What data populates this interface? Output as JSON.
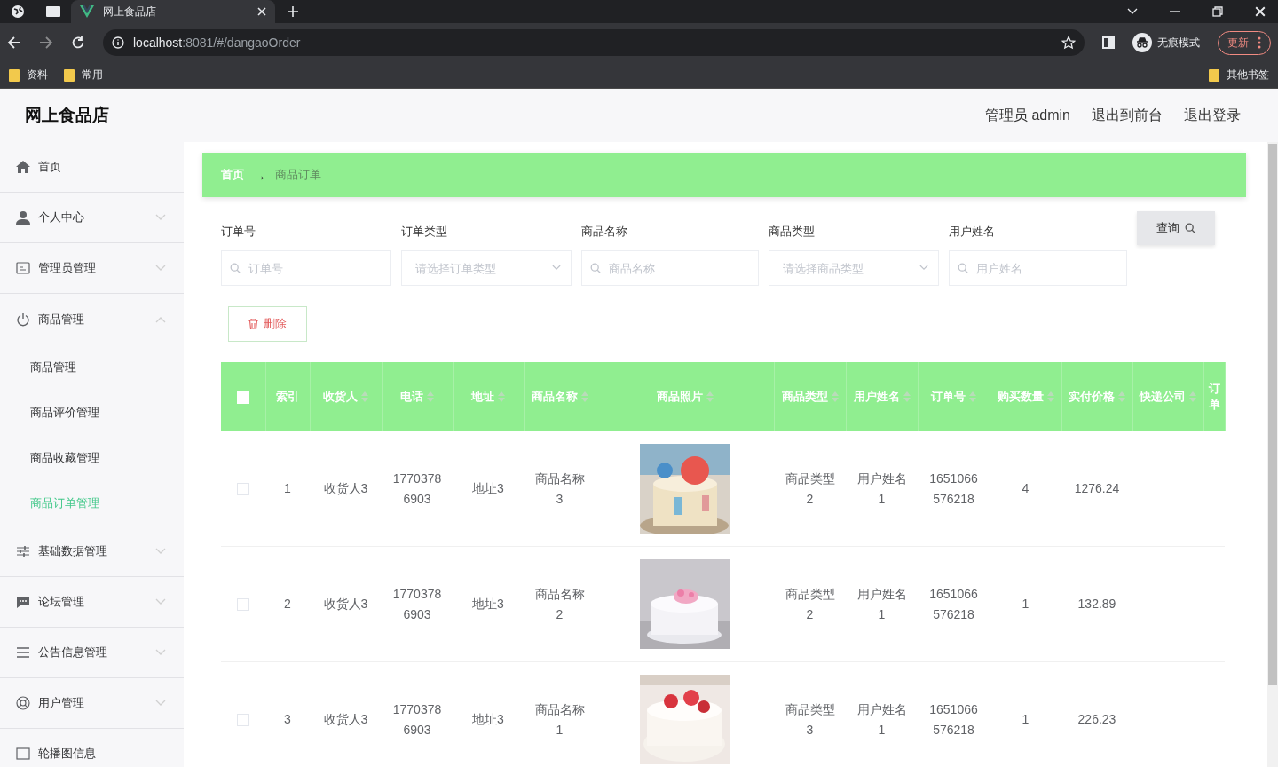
{
  "browser": {
    "tab_title": "网上食品店",
    "url_host": "localhost",
    "url_rest": ":8081/#/dangaoOrder",
    "incognito_label": "无痕模式",
    "update_button": "更新",
    "bookmarks": [
      "资料",
      "常用"
    ],
    "other_bookmarks": "其他书签"
  },
  "app": {
    "title": "网上食品店",
    "user": "管理员 admin",
    "links": [
      "退出到前台",
      "退出登录"
    ]
  },
  "sidebar": {
    "items": [
      {
        "label": "首页",
        "kind": "link"
      },
      {
        "label": "个人中心",
        "kind": "group",
        "expanded": false
      },
      {
        "label": "管理员管理",
        "kind": "group",
        "expanded": false
      },
      {
        "label": "商品管理",
        "kind": "group",
        "expanded": true,
        "children": [
          {
            "label": "商品管理",
            "selected": false
          },
          {
            "label": "商品评价管理",
            "selected": false
          },
          {
            "label": "商品收藏管理",
            "selected": false
          },
          {
            "label": "商品订单管理",
            "selected": true
          }
        ]
      },
      {
        "label": "基础数据管理",
        "kind": "group",
        "expanded": false
      },
      {
        "label": "论坛管理",
        "kind": "group",
        "expanded": false
      },
      {
        "label": "公告信息管理",
        "kind": "group",
        "expanded": false
      },
      {
        "label": "用户管理",
        "kind": "group",
        "expanded": false
      },
      {
        "label": "轮播图信息",
        "kind": "link"
      }
    ]
  },
  "breadcrumb": {
    "items": [
      "首页",
      "商品订单"
    ],
    "separator": "→"
  },
  "search": {
    "fields": [
      {
        "label": "订单号",
        "kind": "input",
        "placeholder": "订单号"
      },
      {
        "label": "订单类型",
        "kind": "select",
        "placeholder": "请选择订单类型"
      },
      {
        "label": "商品名称",
        "kind": "input",
        "placeholder": "商品名称"
      },
      {
        "label": "商品类型",
        "kind": "select",
        "placeholder": "请选择商品类型"
      },
      {
        "label": "用户姓名",
        "kind": "input",
        "placeholder": "用户姓名"
      }
    ],
    "button": "查询"
  },
  "delete_button": "删除",
  "table": {
    "header_checked": false,
    "columns": [
      {
        "label": "索引",
        "kind": "text",
        "sortable": false
      },
      {
        "label": "收货人",
        "kind": "text",
        "sortable": true
      },
      {
        "label": "电话",
        "kind": "text",
        "sortable": true
      },
      {
        "label": "地址",
        "kind": "text",
        "sortable": true
      },
      {
        "label": "商品名称",
        "kind": "text",
        "sortable": true
      },
      {
        "label": "商品照片",
        "kind": "picture",
        "sortable": true
      },
      {
        "label": "商品类型",
        "kind": "text",
        "sortable": true
      },
      {
        "label": "用户姓名",
        "kind": "text",
        "sortable": true
      },
      {
        "label": "订单号",
        "kind": "text",
        "sortable": true
      },
      {
        "label": "购买数量",
        "kind": "text",
        "sortable": true
      },
      {
        "label": "实付价格",
        "kind": "text",
        "sortable": true
      },
      {
        "label": "快递公司",
        "kind": "text",
        "sortable": true
      },
      {
        "label": "订单",
        "kind": "text",
        "sortable": false
      }
    ],
    "rows": [
      {
        "checked": false,
        "cells": [
          "1",
          "收货人3",
          "17703786903",
          "地址3",
          "商品名称3",
          "",
          "商品类型2",
          "用户姓名1",
          "1651066576218",
          "4",
          "1276.24"
        ]
      },
      {
        "checked": false,
        "cells": [
          "2",
          "收货人3",
          "17703786903",
          "地址3",
          "商品名称2",
          "",
          "商品类型2",
          "用户姓名1",
          "1651066576218",
          "1",
          "132.89"
        ]
      },
      {
        "checked": false,
        "cells": [
          "3",
          "收货人3",
          "17703786903",
          "地址3",
          "商品名称1",
          "",
          "商品类型3",
          "用户姓名1",
          "1651066576218",
          "1",
          "226.23"
        ]
      }
    ]
  }
}
